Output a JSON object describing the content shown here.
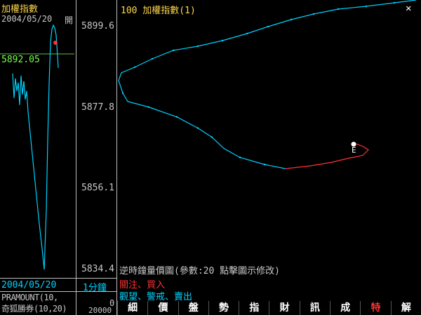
{
  "left_panel": {
    "title": "加權指數",
    "date": "2004/05/20",
    "open_label": "開",
    "price_label": "5892.05",
    "bottom_date": "2004/05/20",
    "period": "1分鐘",
    "indicator_line1": "PRAMOUNT(10,",
    "indicator_line2": "奇狐勝券(10,20)",
    "volume_label": "20000",
    "volume_zero": "0"
  },
  "y_axis": {
    "ticks": [
      "5899.6",
      "5877.8",
      "5856.1",
      "5834.4"
    ]
  },
  "chart": {
    "title": "100 加權指數(1)",
    "close_icon": "close-icon",
    "description": "逆時鐘量價圖(參數:20 點擊圖示修改)",
    "signal_buy": "關注、買入",
    "signal_sell": "觀望、警戒、賣出",
    "end_marker": "E"
  },
  "tabs": [
    {
      "label": "細",
      "active": false
    },
    {
      "label": "價",
      "active": false
    },
    {
      "label": "盤",
      "active": false
    },
    {
      "label": "勢",
      "active": false
    },
    {
      "label": "指",
      "active": false
    },
    {
      "label": "財",
      "active": false
    },
    {
      "label": "訊",
      "active": false
    },
    {
      "label": "成",
      "active": false
    },
    {
      "label": "特",
      "active": true
    },
    {
      "label": "解",
      "active": false
    }
  ],
  "colors": {
    "cyan": "#00d2ff",
    "red": "#ff3333",
    "yellow": "#ffd84a",
    "green": "#7cff4d"
  }
}
